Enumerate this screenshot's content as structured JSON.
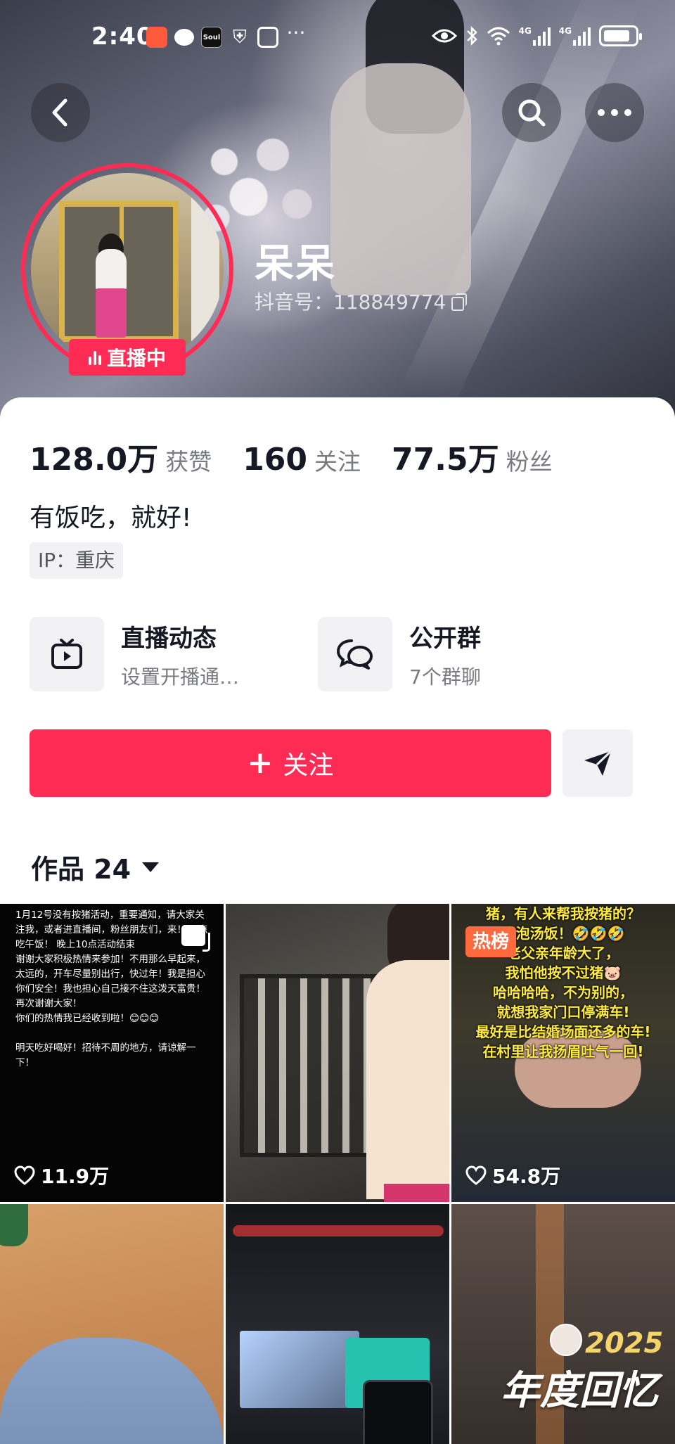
{
  "status_bar": {
    "time": "2:40",
    "network": [
      "4G",
      "4G"
    ],
    "app_icons": [
      "shopping-app-icon",
      "message-icon",
      "soul-app-icon",
      "shield-icon",
      "photo-icon",
      "more-dots-icon"
    ],
    "soul_label": "Soul"
  },
  "header": {
    "back_icon": "chevron-left-icon",
    "search_icon": "search-icon",
    "more_icon": "more-dots-icon"
  },
  "profile": {
    "name": "呆呆",
    "douyin_id": "抖音号：118849774",
    "live_badge": "直播中"
  },
  "stats": [
    {
      "value": "128.0万",
      "label": "获赞"
    },
    {
      "value": "160",
      "label": "关注"
    },
    {
      "value": "77.5万",
      "label": "粉丝"
    }
  ],
  "bio": "有饭吃，就好!",
  "ip": "IP：重庆",
  "features": {
    "live": {
      "title": "直播动态",
      "subtitle": "设置开播通…"
    },
    "group": {
      "title": "公开群",
      "subtitle": "7个群聊"
    }
  },
  "actions": {
    "follow_label": "关注",
    "share_icon": "paper-plane-icon"
  },
  "works": {
    "tab_label": "作品 24"
  },
  "videos": [
    {
      "text": "1月12号没有按猪活动，重要通知，请大家关注我，或者进直播间，粉丝朋友们，来！12点吃午饭！ 晚上10点活动结束\n   谢谢大家积极热情来参加！不用那么早起来，太远的，开车尽量别出行，快过年！我是担心你们安全！我也担心自己接不住这泼天富贵！再次谢谢大家！\n你们的热情我已经收到啦！😊😊😊\n\n   明天吃好喝好！招待不周的地方，请谅解一下！",
      "likes": "11.9万"
    },
    {
      "likes": ""
    },
    {
      "badge": "热榜",
      "caption": "猪，有人来帮我按猪的？\n吃泡汤饭！🤣🤣🤣\n老父亲年龄大了，\n我怕他按不过猪🐷\n哈哈哈哈，不为别的，\n就想我家门口停满车!\n最好是比结婚场面还多的车!\n在村里让我扬眉吐气一回!",
      "likes": "54.8万"
    },
    {
      "likes": ""
    },
    {
      "likes": ""
    },
    {
      "title_year": "2025",
      "title": "年度回忆"
    }
  ],
  "colors": {
    "accent": "#fe2c55",
    "hot_badge": "#fe6a3d",
    "text_primary": "#161823",
    "text_secondary": "#7a7b82"
  }
}
